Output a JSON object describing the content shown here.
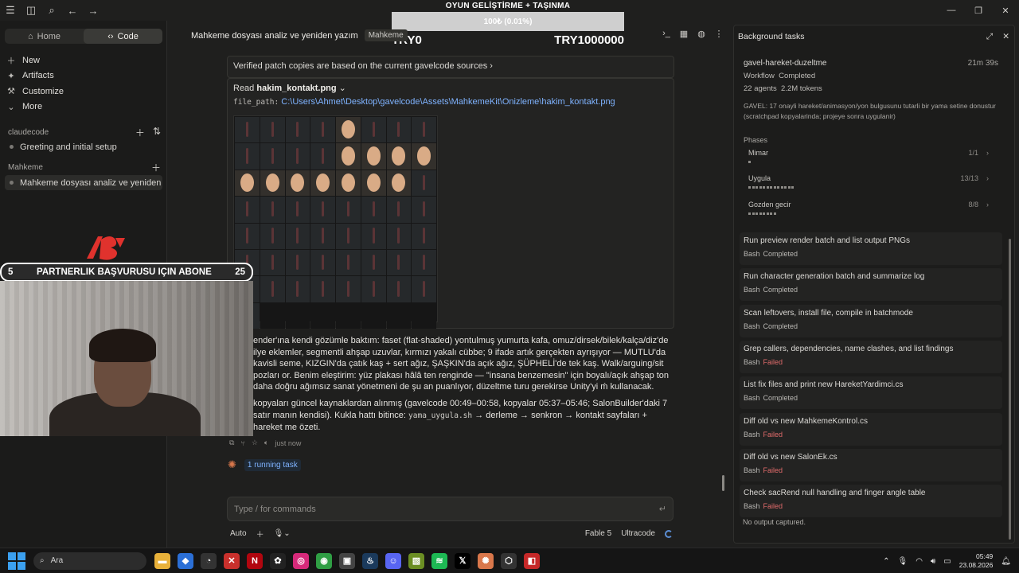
{
  "overlay": {
    "title": "OYUN GELİŞTİRME + TAŞINMA",
    "progress_text": "100₺ (0.01%)",
    "progress_fraction": 0.0001,
    "min_label": "TRY0",
    "max_label": "TRY1000000"
  },
  "sidebar": {
    "tabs": [
      {
        "label": "Home",
        "icon": "home-icon"
      },
      {
        "label": "Code",
        "icon": "code-icon"
      }
    ],
    "nav": [
      {
        "label": "New",
        "icon": "plus-icon"
      },
      {
        "label": "Artifacts",
        "icon": "artifacts-icon"
      },
      {
        "label": "Customize",
        "icon": "customize-icon"
      },
      {
        "label": "More",
        "icon": "chevron-down-icon"
      }
    ],
    "projects": [
      {
        "name": "claudecode",
        "chats": [
          "Greeting and initial setup"
        ]
      },
      {
        "name": "Mahkeme",
        "chats": [
          "Mahkeme dosyası analiz ve yeniden ya"
        ]
      }
    ]
  },
  "header": {
    "title": "Mahkeme dosyası analiz ve yeniden yazım",
    "badge": "Mahkeme"
  },
  "main": {
    "verified_link": "Verified patch copies are based on the current gavelcode sources",
    "read_prefix": "Read",
    "read_file": "hakim_kontakt.png",
    "path_key": "file_path:",
    "path_value": "C:\\Users\\Ahmet\\Desktop\\gavelcode\\Assets\\MahkemeKit\\Onizleme\\hakim_kontakt.png",
    "para1": "ender'ına kendi gözümle baktım: faset (flat-shaded) yontulmuş yumurta kafa, omuz/dirsek/bilek/kalça/diz'de ilye eklemler, segmentli ahşap uzuvlar, kırmızı yakalı cübbe; 9 ifade artık gerçekten ayrışıyor — MUTLU'da kavisli seme, KIZGIN'da çatık kaş + sert ağız, ŞAŞKIN'da açık ağız, ŞÜPHELİ'de tek kaş. Walk/arguing/sit pozları or. Benim eleştirim: yüz plakası hâlâ ten renginde — \"insana benzemesin\" için boyalı/açık ahşap ton daha doğru ağımsız sanat yönetmeni de şu an puanlıyor, düzeltme turu gerekirse Unity'yi ḿ kullanacak.",
    "para2_a": "kopyaları güncel kaynaklardan alınmış (gavelcode 00:49–00:58, kopyalar 05:37–05:46; SalonBuilder'daki 7 satır manın kendisi). Kukla hattı bitince:",
    "para2_code": "yama_uygula.sh",
    "para2_b": "→ derleme → senkron → kontakt sayfaları + hareket me özeti.",
    "timestamp": "just now",
    "running_task": "1 running task"
  },
  "input": {
    "placeholder": "Type / for commands",
    "mode": "Auto",
    "model": "Fable 5",
    "effort": "Ultracode"
  },
  "panel": {
    "title": "Background tasks",
    "workflow": {
      "name": "gavel-hareket-duzeltme",
      "duration": "21m 39s",
      "type": "Workflow",
      "status": "Completed",
      "agents": "22 agents",
      "tokens": "2.2M tokens",
      "description": "GAVEL: 17 onayli hareket/animasyon/yon bulgusunu tutarli bir yama setine donustur (scratchpad kopyalarinda; projeye sonra uygulanir)"
    },
    "phases_label": "Phases",
    "phases": [
      {
        "name": "Mimar",
        "count": "1/1",
        "blocks": 1
      },
      {
        "name": "Uygula",
        "count": "13/13",
        "blocks": 13
      },
      {
        "name": "Gozden gecir",
        "count": "8/8",
        "blocks": 8
      }
    ],
    "tasks": [
      {
        "name": "Run preview render batch and list output PNGs",
        "tool": "Bash",
        "status": "Completed"
      },
      {
        "name": "Run character generation batch and summarize log",
        "tool": "Bash",
        "status": "Completed"
      },
      {
        "name": "Scan leftovers, install file, compile in batchmode",
        "tool": "Bash",
        "status": "Completed"
      },
      {
        "name": "Grep callers, dependencies, name clashes, and list findings",
        "tool": "Bash",
        "status": "Failed"
      },
      {
        "name": "List fix files and print new HareketYardimci.cs",
        "tool": "Bash",
        "status": "Completed"
      },
      {
        "name": "Diff old vs new MahkemeKontrol.cs",
        "tool": "Bash",
        "status": "Failed"
      },
      {
        "name": "Diff old vs new SalonEk.cs",
        "tool": "Bash",
        "status": "Failed"
      },
      {
        "name": "Check sacRend null handling and finger angle table",
        "tool": "Bash",
        "status": "Failed"
      }
    ],
    "no_output": "No output captured."
  },
  "stream": {
    "banner_left": "5",
    "banner_text": "PARTNERLIK BAŞVURUSU IÇIN ABONE",
    "banner_right": "25"
  },
  "taskbar": {
    "search_placeholder": "Ara",
    "time": "05:49",
    "date": "23.08.2026"
  },
  "colors": {
    "accent_link": "#7fb3ff",
    "failed": "#e26b6b",
    "claude_orange": "#d9774b"
  }
}
